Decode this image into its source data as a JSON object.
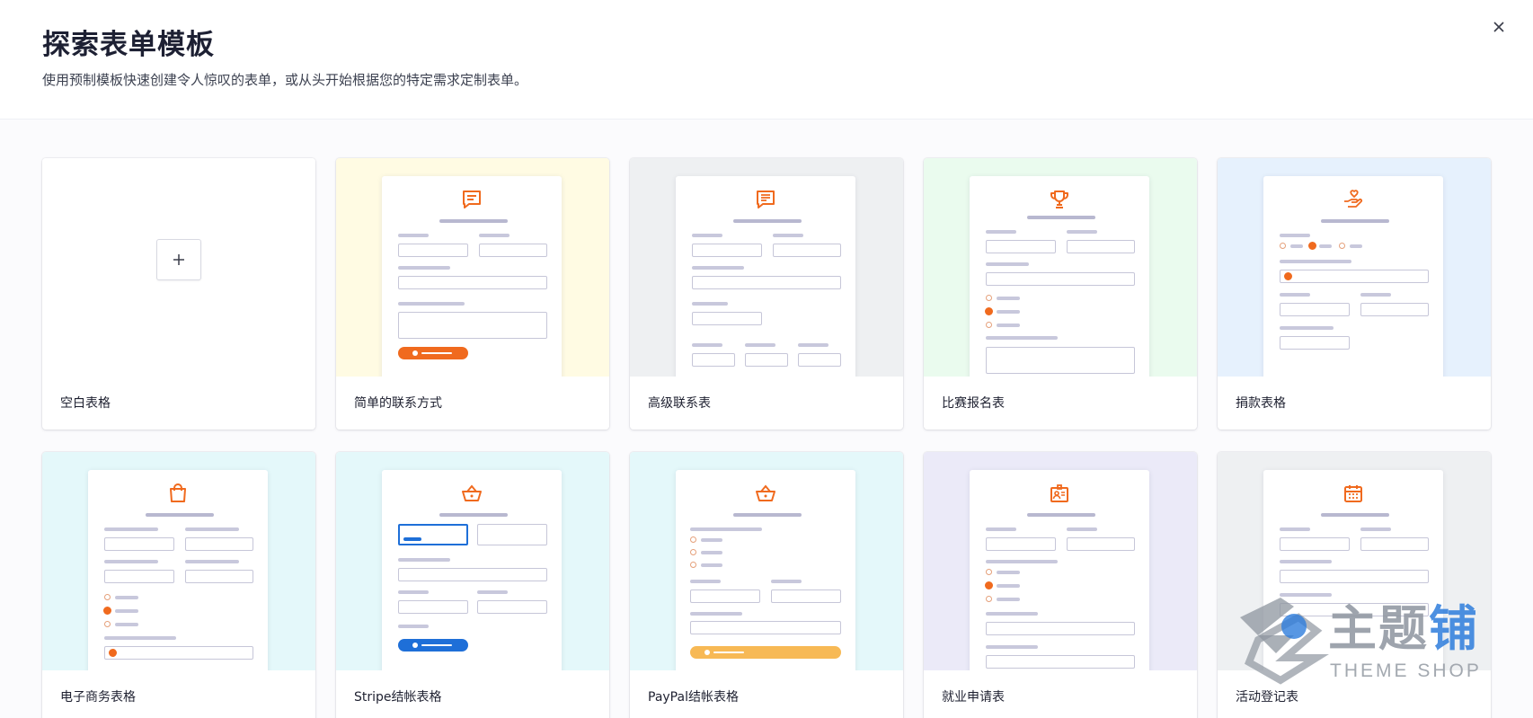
{
  "header": {
    "title": "探索表单模板",
    "subtitle": "使用预制模板快速创建令人惊叹的表单，或从头开始根据您的特定需求定制表单。"
  },
  "icons": {
    "close": "close-icon",
    "plus": "plus-icon"
  },
  "templates": [
    {
      "label": "空白表格",
      "bg": "#ffffff",
      "icon": "plus-icon"
    },
    {
      "label": "简单的联系方式",
      "bg": "#fffbe3",
      "icon": "chat-icon"
    },
    {
      "label": "高级联系表",
      "bg": "#eef0f2",
      "icon": "chat-list-icon"
    },
    {
      "label": "比赛报名表",
      "bg": "#eafbee",
      "icon": "trophy-icon"
    },
    {
      "label": "捐款表格",
      "bg": "#e6f1fd",
      "icon": "donation-heart-icon"
    },
    {
      "label": "电子商务表格",
      "bg": "#e4f8fa",
      "icon": "shopping-bag-icon"
    },
    {
      "label": "Stripe结帐表格",
      "bg": "#e4f8fa",
      "icon": "basket-icon"
    },
    {
      "label": "PayPal结帐表格",
      "bg": "#e4f8fa",
      "icon": "basket-icon"
    },
    {
      "label": "就业申请表",
      "bg": "#ebeaf8",
      "icon": "id-badge-icon"
    },
    {
      "label": "活动登记表",
      "bg": "#eef0f2",
      "icon": "calendar-icon"
    }
  ],
  "watermark": {
    "cn_main": "主题",
    "cn_accent": "铺",
    "en": "THEME SHOP"
  },
  "colors": {
    "accent": "#f06a1e",
    "stripe_blue": "#1e6fd8",
    "paypal_yellow": "#f7b955"
  }
}
